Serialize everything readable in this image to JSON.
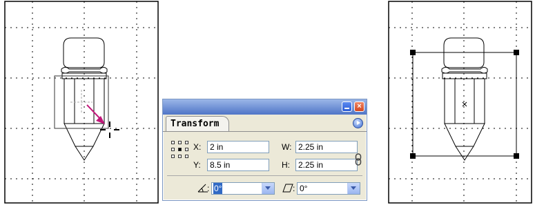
{
  "transform_panel": {
    "tab_label": "Transform",
    "x_label": "X:",
    "x_value": "2 in",
    "y_label": "Y:",
    "y_value": "8.5 in",
    "w_label": "W:",
    "w_value": "2.25 in",
    "h_label": "H:",
    "h_value": "2.25 in",
    "rotate_label": ":",
    "rotate_value": "0°",
    "shear_label": ":",
    "shear_value": "0°"
  },
  "icons": {
    "minimize": "minimize-icon",
    "close": "close-icon",
    "panel_menu": "panel-menu-icon",
    "reference_point": "reference-point-icon",
    "constrain": "link-icon",
    "rotate": "rotate-angle-icon",
    "shear": "shear-angle-icon"
  },
  "colors": {
    "arrow": "#c2177a",
    "panel_bg": "#ece9d8",
    "titlebar": "#4f74c7",
    "selection": "#316ac5"
  }
}
